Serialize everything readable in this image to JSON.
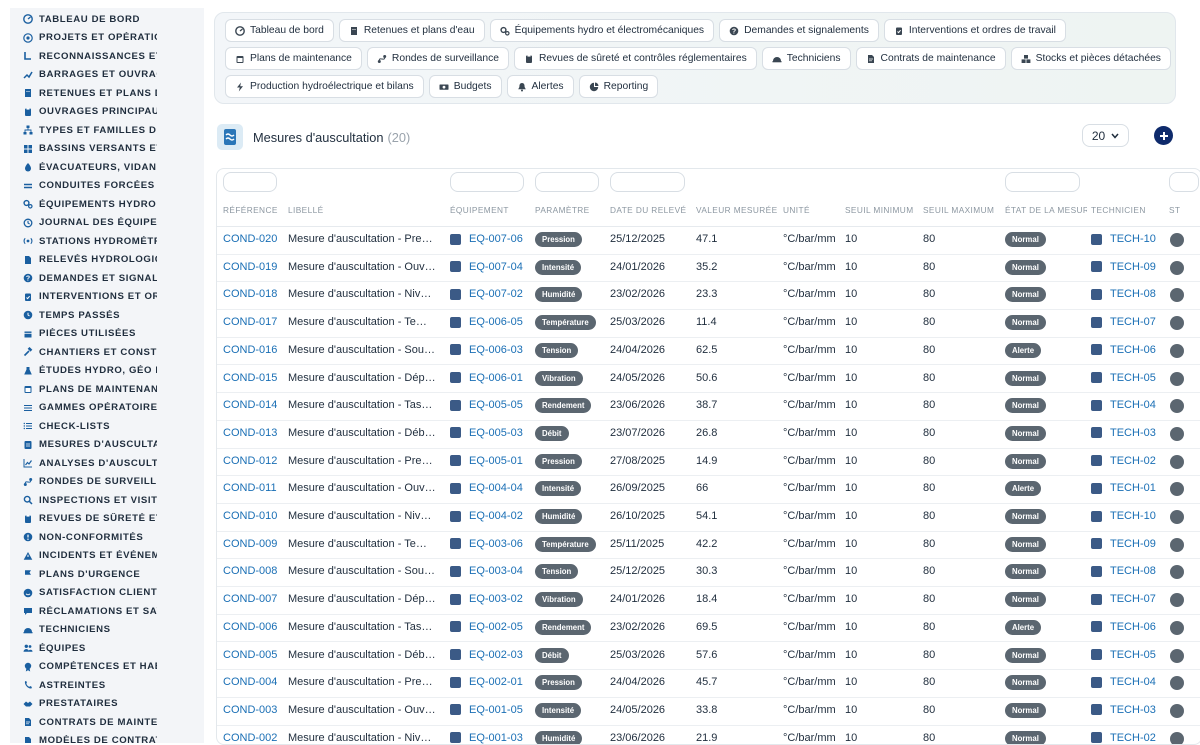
{
  "sidebar": {
    "items": [
      {
        "label": "TABLEAU DE BORD",
        "icon": "dashboard-icon"
      },
      {
        "label": "PROJETS ET OPÉRATIONS",
        "icon": "target-icon"
      },
      {
        "label": "RECONNAISSANCES ET VISITES",
        "icon": "footprint-icon"
      },
      {
        "label": "BARRAGES ET OUVRAGES",
        "icon": "chart-up-icon"
      },
      {
        "label": "RETENUES ET PLANS D'EAU",
        "icon": "building-icon"
      },
      {
        "label": "OUVRAGES PRINCIPAUX",
        "icon": "clipboard-icon"
      },
      {
        "label": "TYPES ET FAMILLES D'OUVRAGES",
        "icon": "sitemap-icon"
      },
      {
        "label": "BASSINS VERSANTS ET AFFLUENTS",
        "icon": "grid-icon"
      },
      {
        "label": "ÉVACUATEURS, VIDANGES",
        "icon": "spray-icon"
      },
      {
        "label": "CONDUITES FORCÉES ET GALERIES",
        "icon": "grip-lines-icon"
      },
      {
        "label": "ÉQUIPEMENTS HYDRO ET ÉLECTROMÉCANIQUES",
        "icon": "cogs-icon"
      },
      {
        "label": "JOURNAL DES ÉQUIPEMENTS",
        "icon": "history-icon"
      },
      {
        "label": "STATIONS HYDROMÉTRIQUES",
        "icon": "broadcast-icon"
      },
      {
        "label": "RELEVÉS HYDROLOGIQUES",
        "icon": "file-icon"
      },
      {
        "label": "DEMANDES ET SIGNALEMENTS",
        "icon": "question-icon"
      },
      {
        "label": "INTERVENTIONS ET ORDRES DE TRAVAIL",
        "icon": "clipboard-check-icon"
      },
      {
        "label": "TEMPS PASSÉS",
        "icon": "clock-icon"
      },
      {
        "label": "PIÈCES UTILISÉES",
        "icon": "box-icon"
      },
      {
        "label": "CHANTIERS ET CONSTRUCTIONS",
        "icon": "hammer-icon"
      },
      {
        "label": "ÉTUDES HYDRO, GÉO ET GÉNIE CIVIL",
        "icon": "flask-icon"
      },
      {
        "label": "PLANS DE MAINTENANCE",
        "icon": "calendar-icon"
      },
      {
        "label": "GAMMES OPÉRATOIRES",
        "icon": "list-icon"
      },
      {
        "label": "CHECK-LISTS",
        "icon": "checklist-icon"
      },
      {
        "label": "MESURES D'AUSCULTATION",
        "icon": "gauge-icon"
      },
      {
        "label": "ANALYSES D'AUSCULTATION",
        "icon": "line-chart-icon"
      },
      {
        "label": "RONDES DE SURVEILLANCE",
        "icon": "route-icon"
      },
      {
        "label": "INSPECTIONS ET VISITES",
        "icon": "search-icon"
      },
      {
        "label": "REVUES DE SÛRETÉ ET CONTRÔLES",
        "icon": "clipboard-icon"
      },
      {
        "label": "NON-CONFORMITÉS",
        "icon": "alert-circle-icon"
      },
      {
        "label": "INCIDENTS ET ÉVÉNEMENTS",
        "icon": "warning-icon"
      },
      {
        "label": "PLANS D'URGENCE",
        "icon": "flag-icon"
      },
      {
        "label": "SATISFACTION CLIENT",
        "icon": "smile-icon"
      },
      {
        "label": "RÉCLAMATIONS ET SAV",
        "icon": "comment-icon"
      },
      {
        "label": "TECHNICIENS",
        "icon": "hard-hat-icon"
      },
      {
        "label": "ÉQUIPES",
        "icon": "users-icon"
      },
      {
        "label": "COMPÉTENCES ET HABILITATIONS",
        "icon": "certificate-icon"
      },
      {
        "label": "ASTREINTES",
        "icon": "phone-icon"
      },
      {
        "label": "PRESTATAIRES",
        "icon": "handshake-icon"
      },
      {
        "label": "CONTRATS DE MAINTENANCE",
        "icon": "file-contract-icon"
      },
      {
        "label": "MODÈLES DE CONTRATS",
        "icon": "file-icon"
      }
    ]
  },
  "menu": {
    "row1": [
      {
        "label": "Tableau de bord",
        "icon": "dashboard-icon"
      },
      {
        "label": "Retenues et plans d'eau",
        "icon": "building-icon"
      },
      {
        "label": "Équipements hydro et électromécaniques",
        "icon": "cogs-icon"
      },
      {
        "label": "Demandes et signalements",
        "icon": "question-icon"
      },
      {
        "label": "Interventions et ordres de travail",
        "icon": "clipboard-check-icon"
      }
    ],
    "row2": [
      {
        "label": "Plans de maintenance",
        "icon": "calendar-icon"
      },
      {
        "label": "Rondes de surveillance",
        "icon": "route-icon"
      },
      {
        "label": "Revues de sûreté et contrôles réglementaires",
        "icon": "clipboard-icon"
      },
      {
        "label": "Techniciens",
        "icon": "hard-hat-icon"
      },
      {
        "label": "Contrats de maintenance",
        "icon": "file-contract-icon"
      },
      {
        "label": "Stocks et pièces détachées",
        "icon": "boxes-icon"
      }
    ],
    "row3": [
      {
        "label": "Production hydroélectrique et bilans",
        "icon": "bolt-icon"
      },
      {
        "label": "Budgets",
        "icon": "money-icon"
      },
      {
        "label": "Alertes",
        "icon": "bell-icon"
      },
      {
        "label": "Reporting",
        "icon": "pie-chart-icon"
      }
    ]
  },
  "page": {
    "title": "Mesures d'auscultation",
    "count": "(20)",
    "page_size": "20"
  },
  "table": {
    "headers": [
      "RÉFÉRENCE",
      "LIBELLÉ",
      "ÉQUIPEMENT",
      "PARAMÈTRE",
      "DATE DU RELEVÉ",
      "VALEUR MESURÉE",
      "UNITÉ",
      "SEUIL MINIMUM",
      "SEUIL MAXIMUM",
      "ÉTAT DE LA MESURE",
      "TECHNICIEN",
      "ST"
    ],
    "rows": [
      [
        "COND-020",
        "Mesure d'auscultation - Pression",
        "EQ-007-06",
        "Pression",
        "25/12/2025",
        "47.1",
        "°C/bar/mm",
        "10",
        "80",
        "Normal",
        "TECH-10"
      ],
      [
        "COND-019",
        "Mesure d'auscultation - Ouverture",
        "EQ-007-04",
        "Intensité",
        "24/01/2026",
        "35.2",
        "°C/bar/mm",
        "10",
        "80",
        "Normal",
        "TECH-09"
      ],
      [
        "COND-018",
        "Mesure d'auscultation - Niveau",
        "EQ-007-02",
        "Humidité",
        "23/02/2026",
        "23.3",
        "°C/bar/mm",
        "10",
        "80",
        "Normal",
        "TECH-08"
      ],
      [
        "COND-017",
        "Mesure d'auscultation - Température",
        "EQ-006-05",
        "Température",
        "25/03/2026",
        "11.4",
        "°C/bar/mm",
        "10",
        "80",
        "Normal",
        "TECH-07"
      ],
      [
        "COND-016",
        "Mesure d'auscultation - Sous-pression",
        "EQ-006-03",
        "Tension",
        "24/04/2026",
        "62.5",
        "°C/bar/mm",
        "10",
        "80",
        "Alerte",
        "TECH-06"
      ],
      [
        "COND-015",
        "Mesure d'auscultation - Déplacement",
        "EQ-006-01",
        "Vibration",
        "24/05/2026",
        "50.6",
        "°C/bar/mm",
        "10",
        "80",
        "Normal",
        "TECH-05"
      ],
      [
        "COND-014",
        "Mesure d'auscultation - Tassement",
        "EQ-005-05",
        "Rendement",
        "23/06/2026",
        "38.7",
        "°C/bar/mm",
        "10",
        "80",
        "Normal",
        "TECH-04"
      ],
      [
        "COND-013",
        "Mesure d'auscultation - Débit de fuite",
        "EQ-005-03",
        "Débit",
        "23/07/2026",
        "26.8",
        "°C/bar/mm",
        "10",
        "80",
        "Normal",
        "TECH-03"
      ],
      [
        "COND-012",
        "Mesure d'auscultation - Pression",
        "EQ-005-01",
        "Pression",
        "27/08/2025",
        "14.9",
        "°C/bar/mm",
        "10",
        "80",
        "Normal",
        "TECH-02"
      ],
      [
        "COND-011",
        "Mesure d'auscultation - Ouverture",
        "EQ-004-04",
        "Intensité",
        "26/09/2025",
        "66",
        "°C/bar/mm",
        "10",
        "80",
        "Alerte",
        "TECH-01"
      ],
      [
        "COND-010",
        "Mesure d'auscultation - Niveau",
        "EQ-004-02",
        "Humidité",
        "26/10/2025",
        "54.1",
        "°C/bar/mm",
        "10",
        "80",
        "Normal",
        "TECH-10"
      ],
      [
        "COND-009",
        "Mesure d'auscultation - Température",
        "EQ-003-06",
        "Température",
        "25/11/2025",
        "42.2",
        "°C/bar/mm",
        "10",
        "80",
        "Normal",
        "TECH-09"
      ],
      [
        "COND-008",
        "Mesure d'auscultation - Sous-pression",
        "EQ-003-04",
        "Tension",
        "25/12/2025",
        "30.3",
        "°C/bar/mm",
        "10",
        "80",
        "Normal",
        "TECH-08"
      ],
      [
        "COND-007",
        "Mesure d'auscultation - Déplacement",
        "EQ-003-02",
        "Vibration",
        "24/01/2026",
        "18.4",
        "°C/bar/mm",
        "10",
        "80",
        "Normal",
        "TECH-07"
      ],
      [
        "COND-006",
        "Mesure d'auscultation - Tassement",
        "EQ-002-05",
        "Rendement",
        "23/02/2026",
        "69.5",
        "°C/bar/mm",
        "10",
        "80",
        "Alerte",
        "TECH-06"
      ],
      [
        "COND-005",
        "Mesure d'auscultation - Débit de fuite",
        "EQ-002-03",
        "Débit",
        "25/03/2026",
        "57.6",
        "°C/bar/mm",
        "10",
        "80",
        "Normal",
        "TECH-05"
      ],
      [
        "COND-004",
        "Mesure d'auscultation - Pression",
        "EQ-002-01",
        "Pression",
        "24/04/2026",
        "45.7",
        "°C/bar/mm",
        "10",
        "80",
        "Normal",
        "TECH-04"
      ],
      [
        "COND-003",
        "Mesure d'auscultation - Ouverture",
        "EQ-001-05",
        "Intensité",
        "24/05/2026",
        "33.8",
        "°C/bar/mm",
        "10",
        "80",
        "Normal",
        "TECH-03"
      ],
      [
        "COND-002",
        "Mesure d'auscultation - Niveau",
        "EQ-001-03",
        "Humidité",
        "23/06/2026",
        "21.9",
        "°C/bar/mm",
        "10",
        "80",
        "Normal",
        "TECH-02"
      ]
    ]
  }
}
